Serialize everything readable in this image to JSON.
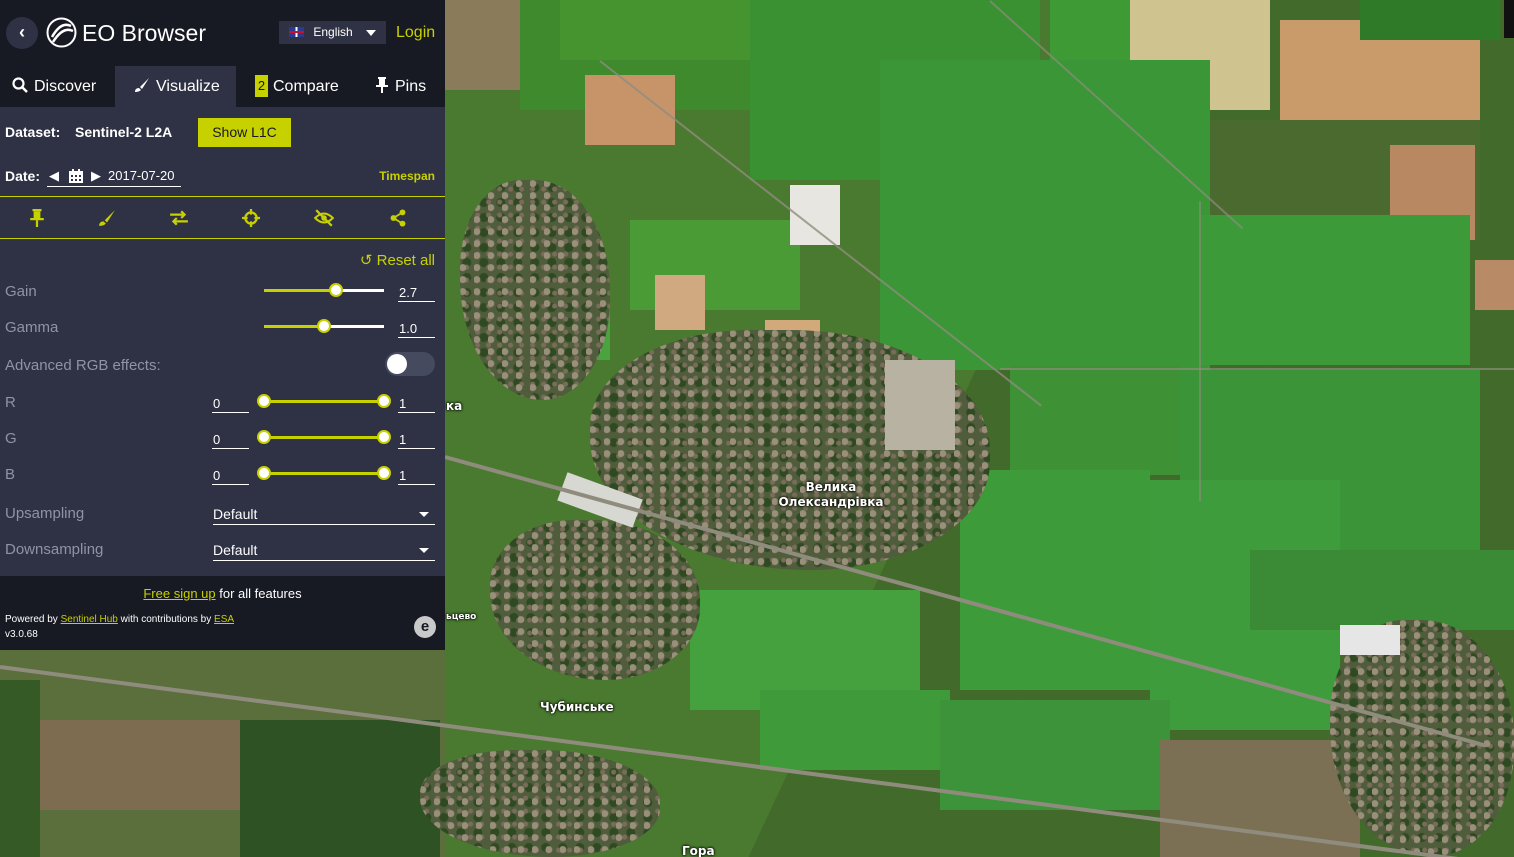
{
  "app": {
    "title": "EO Browser",
    "back_icon": "chevron-left-icon"
  },
  "language": {
    "selected": "English"
  },
  "login_label": "Login",
  "tabs": [
    {
      "label": "Discover",
      "icon": "search-icon"
    },
    {
      "label": "Visualize",
      "icon": "brush-icon",
      "active": true
    },
    {
      "label": "Compare",
      "badge": "2"
    },
    {
      "label": "Pins",
      "icon": "pin-icon"
    }
  ],
  "dataset": {
    "label": "Dataset:",
    "value": "Sentinel-2 L2A",
    "show_l1c": "Show L1C"
  },
  "date": {
    "label": "Date:",
    "value": "2017-07-20",
    "timespan": "Timespan"
  },
  "toolbar_icons": [
    "pin-icon",
    "brush-icon",
    "swap-icon",
    "crosshair-icon",
    "eye-slash-icon",
    "share-icon"
  ],
  "effects": {
    "reset_all": "Reset all",
    "gain": {
      "label": "Gain",
      "value": "2.7",
      "position": 0.6
    },
    "gamma": {
      "label": "Gamma",
      "value": "1.0",
      "position": 0.5
    },
    "advanced_label": "Advanced RGB effects:",
    "advanced_enabled": false,
    "channels": [
      {
        "label": "R",
        "min": "0",
        "max": "1"
      },
      {
        "label": "G",
        "min": "0",
        "max": "1"
      },
      {
        "label": "B",
        "min": "0",
        "max": "1"
      }
    ],
    "upsampling": {
      "label": "Upsampling",
      "value": "Default"
    },
    "downsampling": {
      "label": "Downsampling",
      "value": "Default"
    }
  },
  "footer": {
    "signup_link": "Free sign up",
    "signup_rest": " for all features",
    "powered_by": "Powered by ",
    "sentinel_hub": "Sentinel Hub",
    "contributions": " with contributions by ",
    "esa": "ESA",
    "version": "v3.0.68"
  },
  "map": {
    "labels": {
      "velyka": "Велика\nОлександрівка",
      "chubynske": "Чубинське",
      "hora": "Гора",
      "ka": "ка",
      "tsevo": "ьцево"
    },
    "colors": {
      "accent": "#c8d100",
      "panel": "#2f3244",
      "dark": "#171923"
    }
  }
}
